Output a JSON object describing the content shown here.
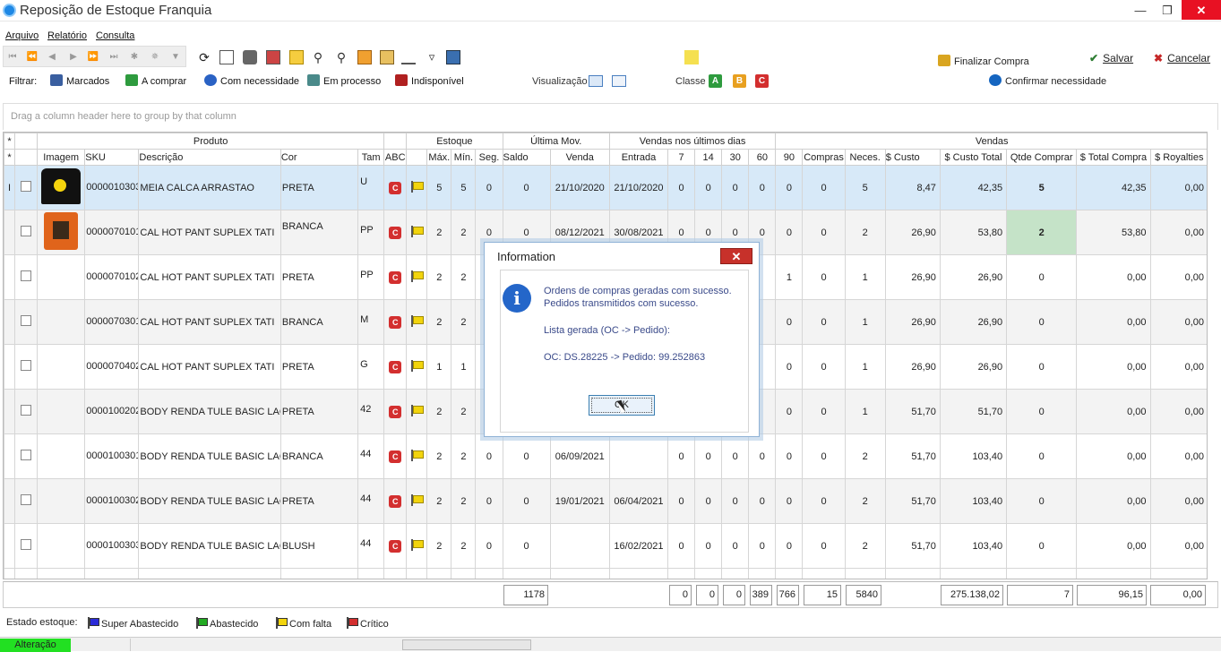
{
  "window": {
    "title": "Reposição de Estoque Franquia"
  },
  "menu": [
    "Arquivo",
    "Relatório",
    "Consulta"
  ],
  "toolbar": {
    "finalizar": "Finalizar Compra",
    "salvar": "Salvar",
    "cancelar": "Cancelar",
    "confirmar": "Confirmar necessidade"
  },
  "filters": {
    "label": "Filtrar:",
    "items": [
      "Marcados",
      "A comprar",
      "Com necessidade",
      "Em processo",
      "Indisponível"
    ],
    "visualizacao": "Visualização",
    "classe": "Classe",
    "classes": [
      "A",
      "B",
      "C"
    ]
  },
  "group_hint": "Drag a column header here to group by that column",
  "groups": {
    "produto": "Produto",
    "estoque": "Estoque",
    "ultima": "Última Mov.",
    "vendas_dias": "Vendas nos últimos dias",
    "vendas": "Vendas"
  },
  "columns": [
    "Imagem",
    "SKU",
    "Descrição",
    "Cor",
    "Tam",
    "ABC",
    "Máx.",
    "Mín.",
    "Seg.",
    "Saldo",
    "Venda",
    "Entrada",
    "7",
    "14",
    "30",
    "60",
    "90",
    "Compras",
    "Neces.",
    "$ Custo",
    "$ Custo Total",
    "Qtde Comprar",
    "$ Total Compra",
    "$ Royalties"
  ],
  "rows": [
    {
      "sku": "0000010303",
      "desc": "MEIA CALCA ARRASTAO",
      "cor": "PRETA",
      "tam": "U",
      "abc": "C",
      "max": "5",
      "min": "5",
      "seg": "0",
      "saldo": "0",
      "venda": "21/10/2020",
      "entrada": "21/10/2020",
      "d7": "0",
      "d14": "0",
      "d30": "0",
      "d60": "0",
      "d90": "0",
      "compras": "0",
      "neces": "5",
      "custo": "8,47",
      "custo_total": "42,35",
      "qtde": "5",
      "total_compra": "42,35",
      "royalties": "0,00"
    },
    {
      "sku": "0000070101",
      "desc": "CAL HOT PANT SUPLEX TATI",
      "cor": "BRANCA",
      "tam": "PP",
      "abc": "C",
      "max": "2",
      "min": "2",
      "seg": "0",
      "saldo": "0",
      "venda": "08/12/2021",
      "entrada": "30/08/2021",
      "d7": "0",
      "d14": "0",
      "d30": "0",
      "d60": "0",
      "d90": "0",
      "compras": "0",
      "neces": "2",
      "custo": "26,90",
      "custo_total": "53,80",
      "qtde": "2",
      "total_compra": "53,80",
      "royalties": "0,00"
    },
    {
      "sku": "0000070102",
      "desc": "CAL HOT PANT SUPLEX TATI",
      "cor": "PRETA",
      "tam": "PP",
      "abc": "C",
      "max": "2",
      "min": "2",
      "seg": "",
      "saldo": "",
      "venda": "",
      "entrada": "",
      "d7": "",
      "d14": "",
      "d30": "",
      "d60": "",
      "d90": "1",
      "compras": "0",
      "neces": "1",
      "custo": "26,90",
      "custo_total": "26,90",
      "qtde": "0",
      "total_compra": "0,00",
      "royalties": "0,00"
    },
    {
      "sku": "0000070301",
      "desc": "CAL HOT PANT SUPLEX TATI",
      "cor": "BRANCA",
      "tam": "M",
      "abc": "C",
      "max": "2",
      "min": "2",
      "seg": "",
      "saldo": "",
      "venda": "",
      "entrada": "",
      "d7": "",
      "d14": "",
      "d30": "",
      "d60": "",
      "d90": "0",
      "compras": "0",
      "neces": "1",
      "custo": "26,90",
      "custo_total": "26,90",
      "qtde": "0",
      "total_compra": "0,00",
      "royalties": "0,00"
    },
    {
      "sku": "0000070402",
      "desc": "CAL HOT PANT SUPLEX TATI",
      "cor": "PRETA",
      "tam": "G",
      "abc": "C",
      "max": "1",
      "min": "1",
      "seg": "",
      "saldo": "",
      "venda": "",
      "entrada": "",
      "d7": "",
      "d14": "",
      "d30": "",
      "d60": "",
      "d90": "0",
      "compras": "0",
      "neces": "1",
      "custo": "26,90",
      "custo_total": "26,90",
      "qtde": "0",
      "total_compra": "0,00",
      "royalties": "0,00"
    },
    {
      "sku": "0000100202",
      "desc": "BODY RENDA TULE BASIC LACE",
      "cor": "PRETA",
      "tam": "42",
      "abc": "C",
      "max": "2",
      "min": "2",
      "seg": "",
      "saldo": "",
      "venda": "",
      "entrada": "",
      "d7": "",
      "d14": "",
      "d30": "",
      "d60": "",
      "d90": "0",
      "compras": "0",
      "neces": "1",
      "custo": "51,70",
      "custo_total": "51,70",
      "qtde": "0",
      "total_compra": "0,00",
      "royalties": "0,00"
    },
    {
      "sku": "0000100301",
      "desc": "BODY RENDA TULE BASIC LACE",
      "cor": "BRANCA",
      "tam": "44",
      "abc": "C",
      "max": "2",
      "min": "2",
      "seg": "0",
      "saldo": "0",
      "venda": "06/09/2021",
      "entrada": "",
      "d7": "0",
      "d14": "0",
      "d30": "0",
      "d60": "0",
      "d90": "0",
      "compras": "0",
      "neces": "2",
      "custo": "51,70",
      "custo_total": "103,40",
      "qtde": "0",
      "total_compra": "0,00",
      "royalties": "0,00"
    },
    {
      "sku": "0000100302",
      "desc": "BODY RENDA TULE BASIC LACE",
      "cor": "PRETA",
      "tam": "44",
      "abc": "C",
      "max": "2",
      "min": "2",
      "seg": "0",
      "saldo": "0",
      "venda": "19/01/2021",
      "entrada": "06/04/2021",
      "d7": "0",
      "d14": "0",
      "d30": "0",
      "d60": "0",
      "d90": "0",
      "compras": "0",
      "neces": "2",
      "custo": "51,70",
      "custo_total": "103,40",
      "qtde": "0",
      "total_compra": "0,00",
      "royalties": "0,00"
    },
    {
      "sku": "0000100303",
      "desc": "BODY RENDA TULE BASIC LACE",
      "cor": "BLUSH",
      "tam": "44",
      "abc": "C",
      "max": "2",
      "min": "2",
      "seg": "0",
      "saldo": "0",
      "venda": "",
      "entrada": "16/02/2021",
      "d7": "0",
      "d14": "0",
      "d30": "0",
      "d60": "0",
      "d90": "0",
      "compras": "0",
      "neces": "2",
      "custo": "51,70",
      "custo_total": "103,40",
      "qtde": "0",
      "total_compra": "0,00",
      "royalties": "0,00"
    }
  ],
  "totals": {
    "saldo": "1178",
    "d7": "0",
    "d14": "0",
    "d30": "0",
    "d60": "389",
    "d90": "766",
    "compras": "15",
    "neces": "5840",
    "custo_total": "275.138,02",
    "qtde": "7",
    "total_compra": "96,15",
    "royalties": "0,00"
  },
  "legend": {
    "label": "Estado estoque:",
    "items": [
      "Super Abastecido",
      "Abastecido",
      "Com falta",
      "Crítico"
    ],
    "colors": [
      "#2b2bd8",
      "#22aa22",
      "#f2d40d",
      "#d32f2f"
    ]
  },
  "status": {
    "text": "Alteração"
  },
  "dialog": {
    "title": "Information",
    "line1": "Ordens de compras geradas com sucesso.",
    "line2": "Pedidos transmitidos com sucesso.",
    "line3": "Lista gerada (OC -> Pedido):",
    "line4": "OC: DS.28225 -> Pedido: 99.252863",
    "ok": "OK"
  }
}
